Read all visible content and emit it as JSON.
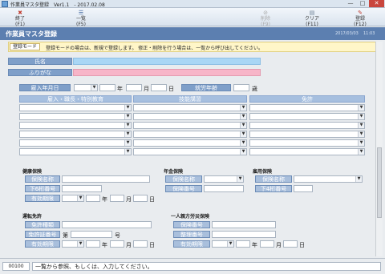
{
  "window": {
    "title": "作業員マスタ登録　Ver1.1　- 2017.02.08",
    "min": "—",
    "max": "□",
    "close": "✕"
  },
  "toolbar": {
    "end": {
      "label": "終了",
      "key": "(F1)"
    },
    "list": {
      "label": "一覧",
      "key": "(F5)"
    },
    "delete": {
      "label": "削除",
      "key": "(F9)"
    },
    "clear": {
      "label": "クリア",
      "key": "(F11)"
    },
    "register": {
      "label": "登録",
      "key": "(F12)"
    }
  },
  "header": {
    "title": "作業員マスタ登録",
    "date": "2017/03/03",
    "time": "11:03"
  },
  "mode": {
    "badge": "登録モード",
    "text": "登録モードの場合は、新規で登録します。 修正・削除を行う場合は、一覧から呼び出してください。"
  },
  "person": {
    "name_label": "氏名",
    "kana_label": "ふりがな",
    "name_value": "",
    "kana_value": ""
  },
  "hire": {
    "label": "雇入年月日",
    "year": "年",
    "month": "月",
    "day": "日",
    "age_label": "就労年齢",
    "age_unit": "歳"
  },
  "grid": {
    "col1": "雇入・職長・特別教育",
    "col2": "技能講習",
    "col3": "免許",
    "rows": 6
  },
  "health": {
    "title": "健康保険",
    "name_label": "保険名称",
    "digits_label": "下6桁番号",
    "expiry_label": "有効期限",
    "year": "年",
    "month": "月",
    "day": "日"
  },
  "pension": {
    "title": "年金保険",
    "name_label": "保険名称",
    "number_label": "保険番号"
  },
  "employment": {
    "title": "雇用保険",
    "name_label": "保険名称",
    "digits_label": "下4桁番号"
  },
  "license": {
    "title": "運転免許",
    "type_label": "免許種類",
    "number_label": "免許証番号",
    "number_prefix": "第",
    "number_suffix": "号",
    "expiry_label": "有効期限",
    "year": "年",
    "month": "月",
    "day": "日"
  },
  "accident": {
    "title": "一人親方労災保険",
    "number_label": "保険番号",
    "mgmt_label": "整理番号",
    "expiry_label": "有効期限",
    "year": "年",
    "month": "月",
    "day": "日"
  },
  "status": {
    "code": "00100",
    "message": "一覧から参照、もしくは、入力してください。"
  },
  "colors": {
    "header": "#5c7fb0",
    "label": "#7f9fc9",
    "name_field": "#a9d6f5",
    "kana_field": "#f7b5c8",
    "mode_bg": "#fff6c8"
  }
}
